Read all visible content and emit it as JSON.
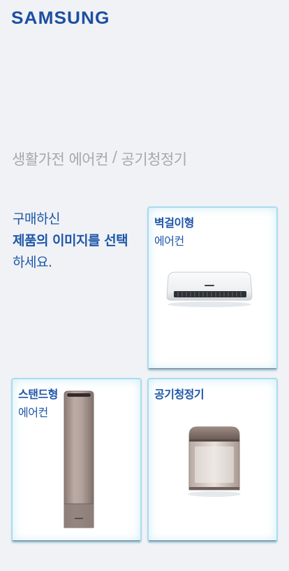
{
  "header": {
    "logo_text": "SAMSUNG"
  },
  "breadcrumb": {
    "category": "생활가전 에어컨",
    "separator": "/",
    "current": "공기청정기"
  },
  "prompt": {
    "line1": "구매하신",
    "line2": "제품의 이미지를 선택",
    "line3": "하세요."
  },
  "products": [
    {
      "title": "벽걸이형",
      "subtitle": "에어컨",
      "image_icon": "wall-mounted-ac-image"
    },
    {
      "title": "스탠드형",
      "subtitle": "에어컨",
      "image_icon": "stand-ac-image"
    },
    {
      "title": "공기청정기",
      "subtitle": "",
      "image_icon": "air-purifier-image"
    }
  ],
  "colors": {
    "brand": "#1d4fa0",
    "text": "#1e56a8",
    "breadcrumb": "#a5a8ae",
    "card_border": "#a9dcee",
    "background": "#f0f2f6"
  }
}
